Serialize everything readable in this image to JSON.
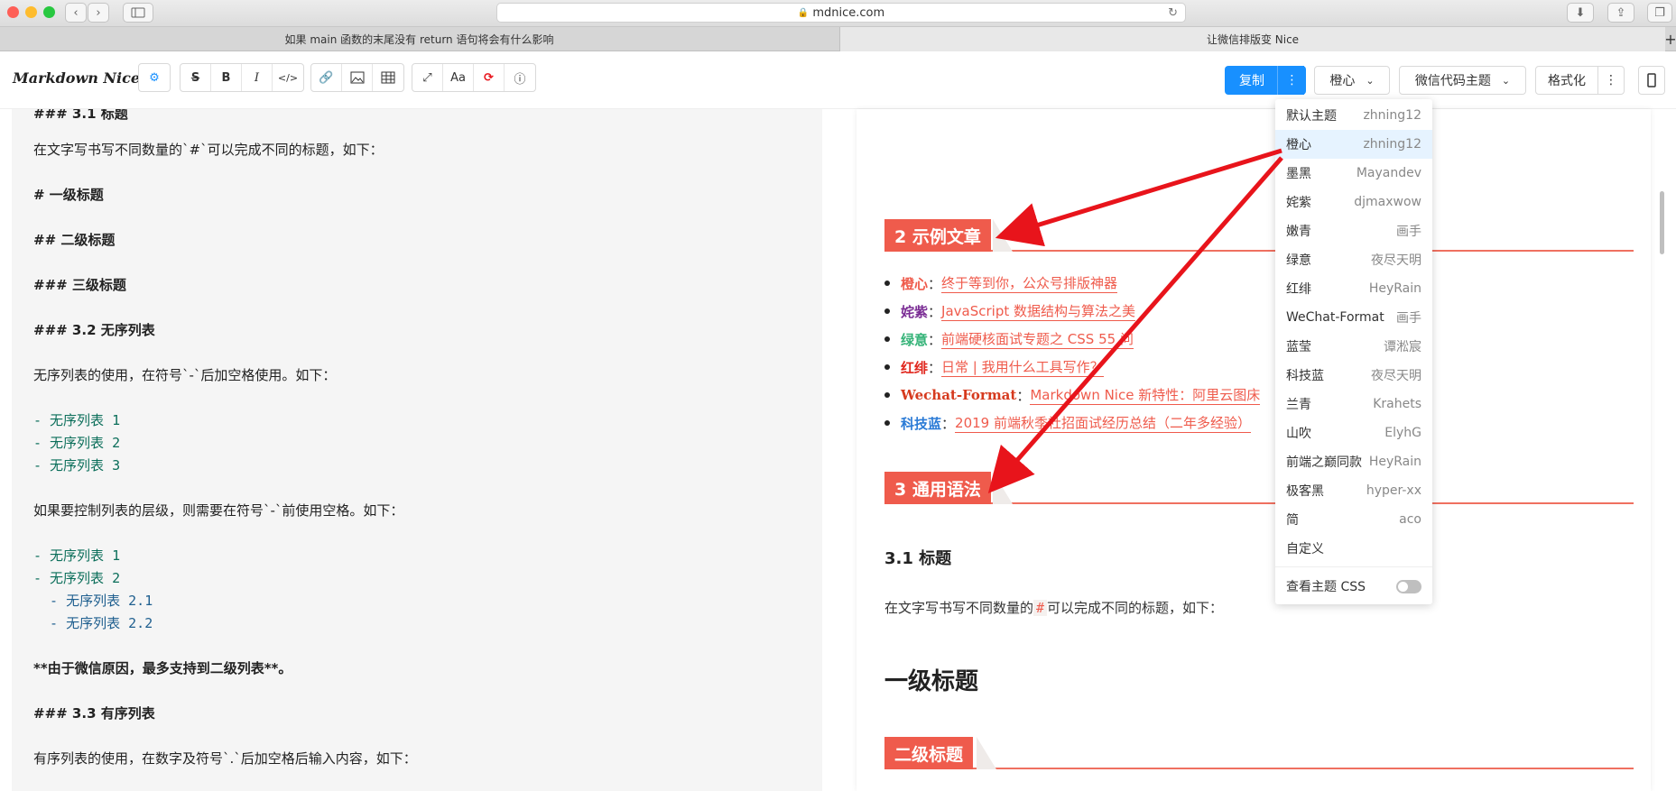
{
  "browser": {
    "url": "mdnice.com",
    "tabs": [
      "如果 main 函数的末尾没有 return 语句将会有什么影响",
      "让微信排版变 Nice"
    ]
  },
  "toolbar": {
    "logo": "Markdown Nice",
    "copy_label": "复制",
    "theme_select": "橙心",
    "code_theme_select": "微信代码主题",
    "format_label": "格式化",
    "icons": [
      "settings-icon",
      "strikethrough-icon",
      "bold-icon",
      "italic-icon",
      "code-icon",
      "link-icon",
      "image-icon",
      "table-icon",
      "fullscreen-icon",
      "font-icon",
      "sync-icon",
      "info-icon"
    ]
  },
  "editor": {
    "lines": [
      "### 3.1 标题",
      "在文字写书写不同数量的`#`可以完成不同的标题，如下：",
      "# 一级标题",
      "## 二级标题",
      "### 三级标题",
      "### 3.2 无序列表",
      "无序列表的使用，在符号`-`后加空格使用。如下：",
      "- 无序列表 1",
      "- 无序列表 2",
      "- 无序列表 3",
      "如果要控制列表的层级，则需要在符号`-`前使用空格。如下：",
      "- 无序列表 1",
      "- 无序列表 2",
      "  - 无序列表 2.1",
      "  - 无序列表 2.2",
      "**由于微信原因，最多支持到二级列表**。",
      "### 3.3 有序列表",
      "有序列表的使用，在数字及符号`.`后加空格后输入内容，如下："
    ]
  },
  "preview": {
    "h2_examples": "2 示例文章",
    "list": [
      {
        "name": "橙心",
        "sep": "：",
        "link": "终于等到你，公众号排版神器",
        "color": "#ef5b4c"
      },
      {
        "name": "姹紫",
        "sep": "：",
        "link": "JavaScript 数据结构与算法之美",
        "color": "#7a2c94"
      },
      {
        "name": "绿意",
        "sep": "：",
        "link": "前端硬核面试专题之 CSS 55 问",
        "color": "#35b378"
      },
      {
        "name": "红绯",
        "sep": "：",
        "link": "日常 | 我用什么工具写作？",
        "color": "#e0251c"
      },
      {
        "name": "Wechat-Format",
        "sep": "：",
        "link": "Markdown Nice 新特性：阿里云图床",
        "color": "#d63a1e"
      },
      {
        "name": "科技蓝",
        "sep": "：",
        "link": "2019 前端秋季社招面试经历总结（二年多经验）",
        "color": "#2b7bd6"
      }
    ],
    "h2_syntax": "3 通用语法",
    "h3": "3.1 标题",
    "para_before": "在文字写书写不同数量的",
    "para_code": "#",
    "para_after": "可以完成不同的标题，如下：",
    "h1": "一级标题",
    "h2_level": "二级标题"
  },
  "theme_menu": {
    "items": [
      {
        "name": "默认主题",
        "author": "zhning12"
      },
      {
        "name": "橙心",
        "author": "zhning12"
      },
      {
        "name": "墨黑",
        "author": "Mayandev"
      },
      {
        "name": "姹紫",
        "author": "djmaxwow"
      },
      {
        "name": "嫩青",
        "author": "画手"
      },
      {
        "name": "绿意",
        "author": "夜尽天明"
      },
      {
        "name": "红绯",
        "author": "HeyRain"
      },
      {
        "name": "WeChat-Format",
        "author": "画手"
      },
      {
        "name": "蓝莹",
        "author": "谭淞宸"
      },
      {
        "name": "科技蓝",
        "author": "夜尽天明"
      },
      {
        "name": "兰青",
        "author": "Krahets"
      },
      {
        "name": "山吹",
        "author": "ElyhG"
      },
      {
        "name": "前端之巅同款",
        "author": "HeyRain"
      },
      {
        "name": "极客黑",
        "author": "hyper-xx"
      },
      {
        "name": "简",
        "author": "aco"
      },
      {
        "name": "自定义",
        "author": ""
      }
    ],
    "selected_index": 1,
    "view_css_label": "查看主题 CSS",
    "view_css_enabled": false
  },
  "colors": {
    "accent": "#1890ff",
    "theme_red": "#ef5b4c",
    "arrow": "#e8141b"
  }
}
